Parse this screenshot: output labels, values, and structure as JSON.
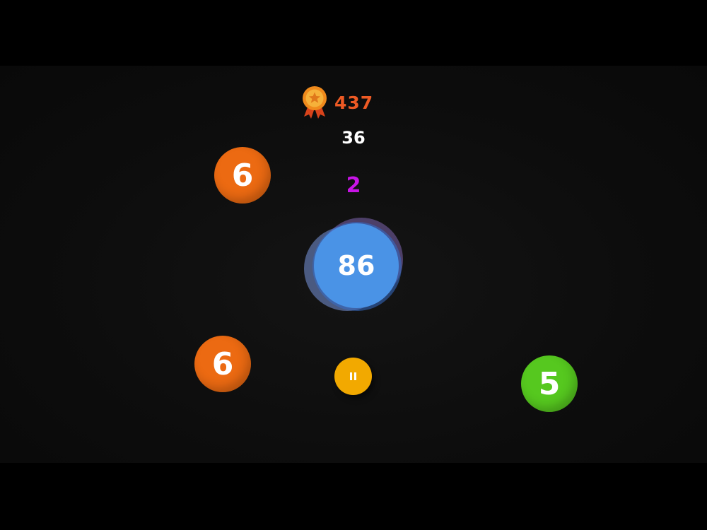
{
  "hud": {
    "best_score": "437",
    "best_icon": "medal-icon",
    "score": "36",
    "combo": "2"
  },
  "player": {
    "value": "86"
  },
  "balls": [
    {
      "value": "6",
      "color": "#ec6a12"
    },
    {
      "value": "6",
      "color": "#ec6a12"
    },
    {
      "value": "5",
      "color": "#56c81f"
    }
  ],
  "pause_button": {
    "icon": "pause-icon"
  },
  "colors": {
    "best_score": "#ee5a24",
    "score": "#ffffff",
    "combo": "#c814e6",
    "player_ball": "#4a93e6",
    "orange_ball": "#ec6a12",
    "green_ball": "#56c81f",
    "pause_button": "#f2a900",
    "background": "#0d0d0d"
  }
}
